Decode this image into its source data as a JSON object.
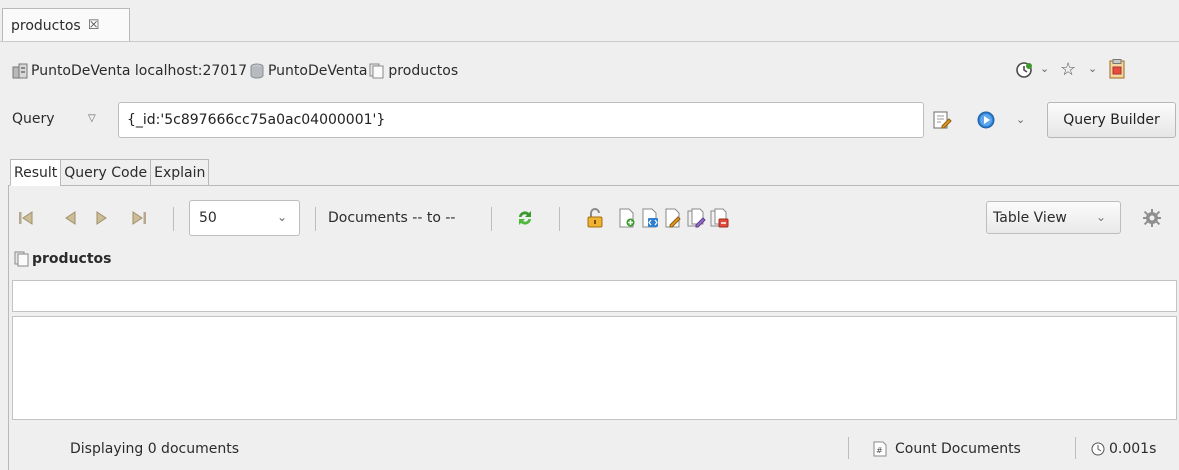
{
  "editor_tab": {
    "label": "productos",
    "close_glyph": "☒"
  },
  "breadcrumb": {
    "server": "PuntoDeVenta localhost:27017",
    "database": "PuntoDeVenta",
    "collection": "productos"
  },
  "query": {
    "label": "Query",
    "value": "{_id:'5c897666cc75a0ac04000001'}",
    "query_builder_label": "Query Builder"
  },
  "result_tabs": [
    {
      "label": "Result",
      "active": true
    },
    {
      "label": "Query Code",
      "active": false
    },
    {
      "label": "Explain",
      "active": false
    }
  ],
  "toolbar": {
    "page_size": "50",
    "documents_range": "Documents -- to --",
    "view_mode": "Table View"
  },
  "collection_label": "productos",
  "status_bar": {
    "message": "Displaying 0 documents",
    "count_label": "Count Documents",
    "elapsed": "0.001s"
  },
  "colors": {
    "accent_green": "#3c9a2d",
    "accent_blue": "#2f7fd1",
    "accent_orange": "#e39a1f",
    "db_gray": "#9aa0a6"
  }
}
